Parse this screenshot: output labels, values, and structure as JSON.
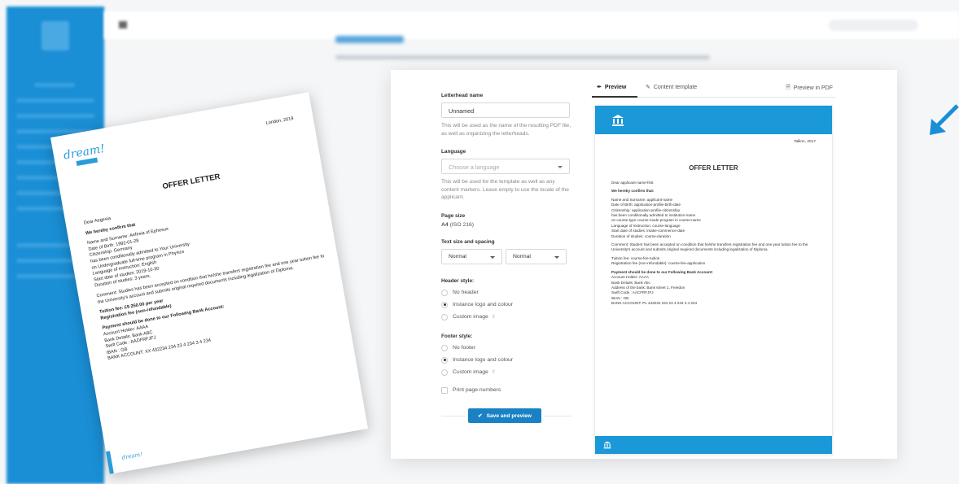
{
  "colors": {
    "accent": "#1a98d8",
    "button": "#1a82c4",
    "brand": "#2a9cd8"
  },
  "form": {
    "name_label": "Letterhead name",
    "name_value": "Unnamed",
    "name_hint": "This will be used as the name of the resulting PDF file, as well as organizing the letterheads.",
    "language_label": "Language",
    "language_placeholder": "Choose a language",
    "language_hint": "This will be used for the template as well as any content markers. Leave empty to use the locale of the applicant.",
    "page_size_label": "Page size",
    "page_size_value": "A4",
    "page_size_std": "(ISO 216)",
    "text_size_label": "Text size and spacing",
    "text_size_value": "Normal",
    "spacing_value": "Normal",
    "header_label": "Header style:",
    "header_options": [
      "No header",
      "Instance logo and colour",
      "Custom image"
    ],
    "footer_label": "Footer style:",
    "footer_options": [
      "No footer",
      "Instance logo and colour",
      "Custom image"
    ],
    "print_page_numbers": "Print page numbers",
    "save_button": "Save and preview"
  },
  "tabs": {
    "preview": "Preview",
    "content_template": "Content template",
    "preview_pdf": "Preview in PDF"
  },
  "preview_doc": {
    "city": "Tallinn, 2017",
    "title": "OFFER LETTER",
    "greeting": "Dear applicant-name-first",
    "confirm": "We hereby confirm that:",
    "lines": [
      "Name and Surname: applicant-name",
      "Date of Birth: application-profile-birth-date",
      "Citizenship: application-profile-citizenship",
      "has been conditionally admitted to institution-name",
      "on course-type course-mode program in course-name",
      "Language of instruction: course-language",
      "Start date of studies: intake-commence-date",
      "Duration of studies: course-duration"
    ],
    "comment": "Comment: Student has been accepted on condition that he/she transfers registration fee and one year tuition fee to the University's account and submits original required documents including legalization of Diploma.",
    "tuition": "Tuition fee: course-fee-tuition",
    "registration": "Registration fee (non-refundable): course-fee-application",
    "payment_head": "Payment should be done to our Following Bank Account:",
    "bank_lines": [
      "Account Holder: AAAA",
      "Bank Details: Bank Abc",
      "Address of the bank: Bank street 1, Freedon",
      "Swift Code : AACFRFJFJ",
      "IBAN : GB",
      "BANK ACCOUNT: PL 443234 234 23 4 234 3 4 234"
    ]
  },
  "letter": {
    "brand": "dream!",
    "city": "London, 2019",
    "title": "OFFER LETTER",
    "greeting": "Dear Aegesia",
    "confirm": "We hereby confirm that",
    "lines": [
      "Name and Surname: Aefesia of Ephesus",
      "Date of Birth: 1992-01-28",
      "Citizenship: Germany",
      "has been conditionally admitted to Your University",
      "on Undergraduate full-time program in Physics",
      "Language of instruction: English",
      "Start date of studies: 2019-10-30",
      "Duration of studies: 3 years."
    ],
    "comment": "Comment: Studies has been accepted on condition that he/she transfers registration fee and one year tuition fee to the University's account and submits original required documents including legalization of Diploma.",
    "tuition": "Tuition fee: £9 250.00 per year",
    "registration": "Registration fee (non-refundable)",
    "payment_head": "Payment should be done to our Following Bank Account:",
    "bank_lines": [
      "Account Holder: AAAA",
      "Bank Details: Bank ABC",
      "Swift Code : AADFRFJFJ",
      "IBAN : GB",
      "BANK ACCOUNT: XX 432234 234 23 4 234 3 4 234"
    ],
    "footer_brand": "dream!"
  }
}
